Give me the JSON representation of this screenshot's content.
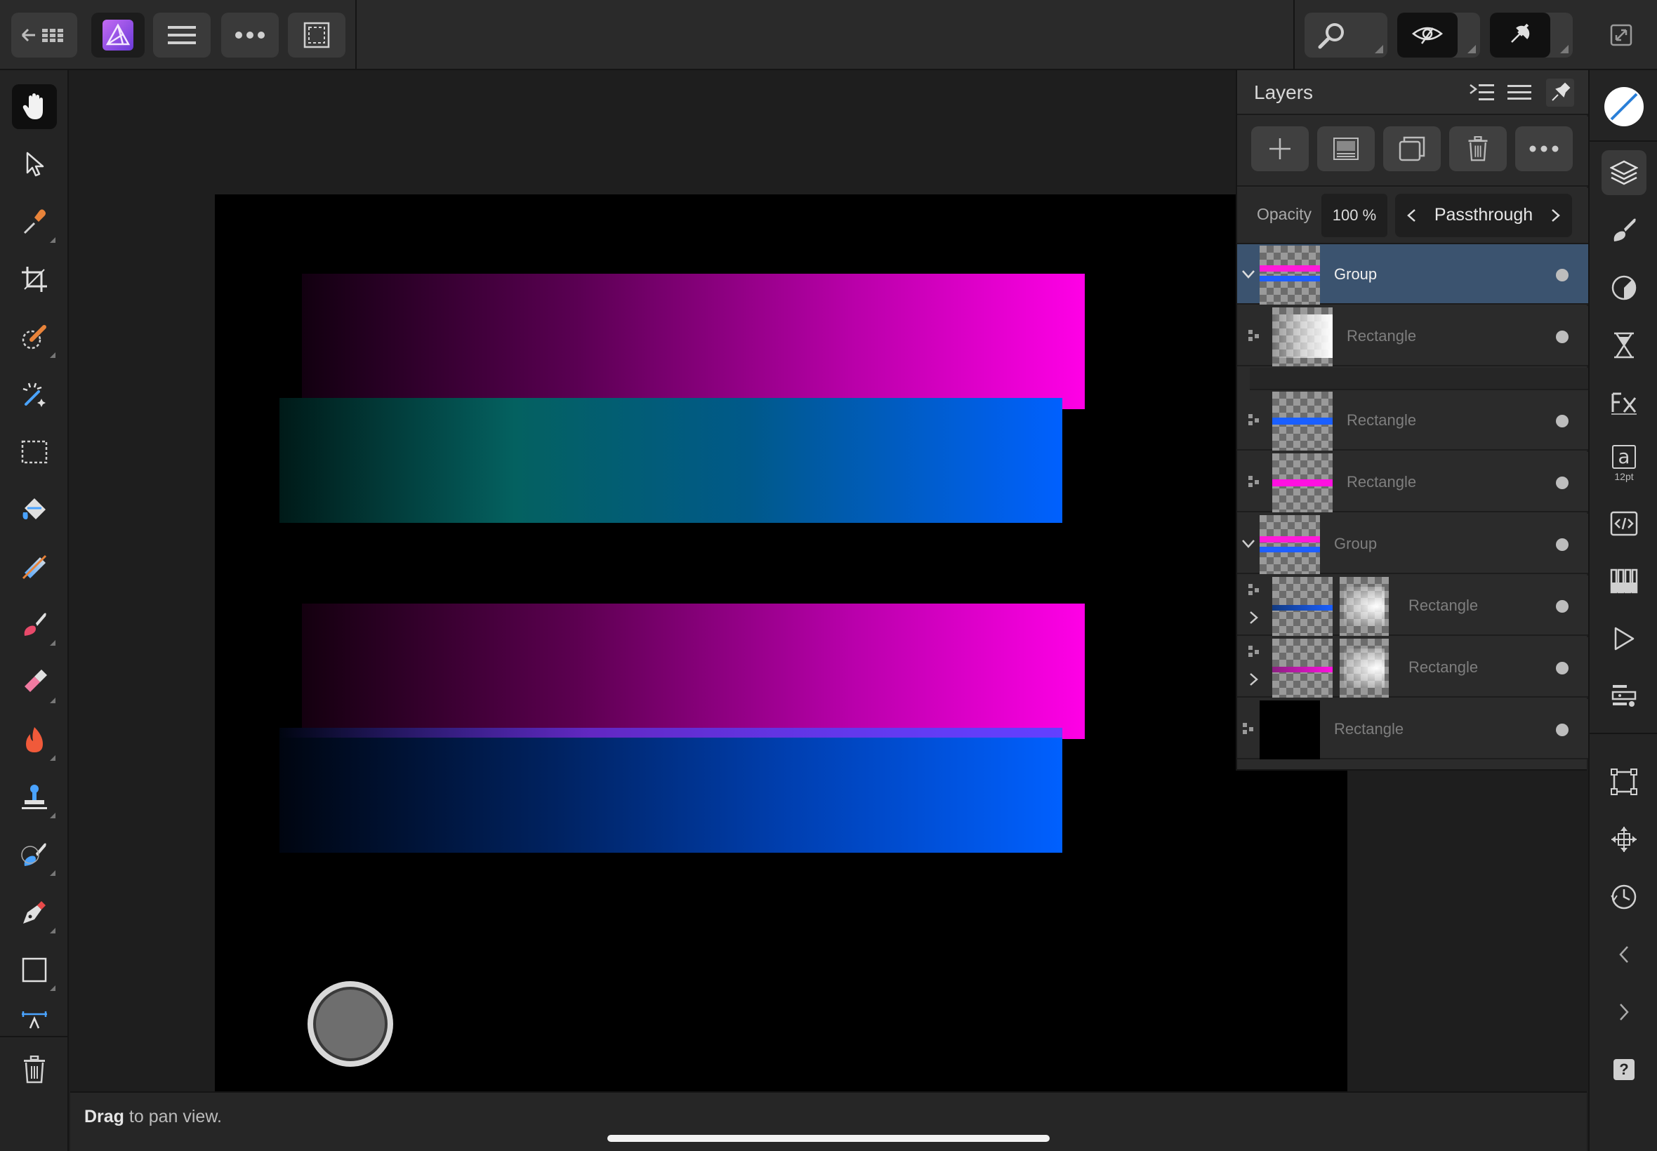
{
  "app": {
    "name": "Affinity Photo",
    "accent": "#9b5cf6"
  },
  "topbar": {
    "left_buttons": [
      "back-grid-icon",
      "app-logo-icon",
      "menu-icon",
      "more-icon",
      "selection-icon"
    ],
    "right_buttons": [
      "zoom-icon",
      "view-icon",
      "snapping-icon"
    ],
    "corner_button": "expand-icon"
  },
  "tools": [
    {
      "icon": "hand-icon",
      "active": true
    },
    {
      "icon": "move-arrow-icon"
    },
    {
      "icon": "eyedropper-icon"
    },
    {
      "icon": "crop-icon"
    },
    {
      "icon": "selection-brush-icon"
    },
    {
      "icon": "magic-wand-icon"
    },
    {
      "icon": "marquee-icon"
    },
    {
      "icon": "fill-bucket-icon"
    },
    {
      "icon": "gradient-icon"
    },
    {
      "icon": "paint-brush-icon"
    },
    {
      "icon": "eraser-icon"
    },
    {
      "icon": "burn-icon"
    },
    {
      "icon": "clone-stamp-icon"
    },
    {
      "icon": "retouch-brush-icon"
    },
    {
      "icon": "pen-icon"
    },
    {
      "icon": "rectangle-icon"
    },
    {
      "icon": "text-frame-icon"
    }
  ],
  "status": {
    "bold": "Drag",
    "rest": " to pan view."
  },
  "layers_panel": {
    "title": "Layers",
    "opacity_label": "Opacity",
    "opacity_value": "100 %",
    "blend_mode": "Passthrough",
    "layers": [
      {
        "name": "Group",
        "selected": true,
        "expanded": true,
        "thumb": "group-pink-blue"
      },
      {
        "name": "Rectangle",
        "thumb": "white-fade"
      },
      {
        "name": "Rectangle",
        "thumb": "blue-stripe"
      },
      {
        "name": "Rectangle",
        "thumb": "pink-stripe"
      },
      {
        "name": "Group",
        "expanded": true,
        "thumb": "group-pink-blue"
      },
      {
        "name": "Rectangle",
        "thumb": "blue-stripe-masked"
      },
      {
        "name": "Rectangle",
        "thumb": "pink-stripe-masked"
      },
      {
        "name": "Rectangle",
        "thumb": "black"
      }
    ]
  },
  "right_icons": {
    "font_size": "12pt",
    "font_letter": "a",
    "help": "?"
  },
  "colors": {
    "magenta": "#ff00e6",
    "blue": "#0060ff",
    "selected_row": "#3b536f"
  }
}
